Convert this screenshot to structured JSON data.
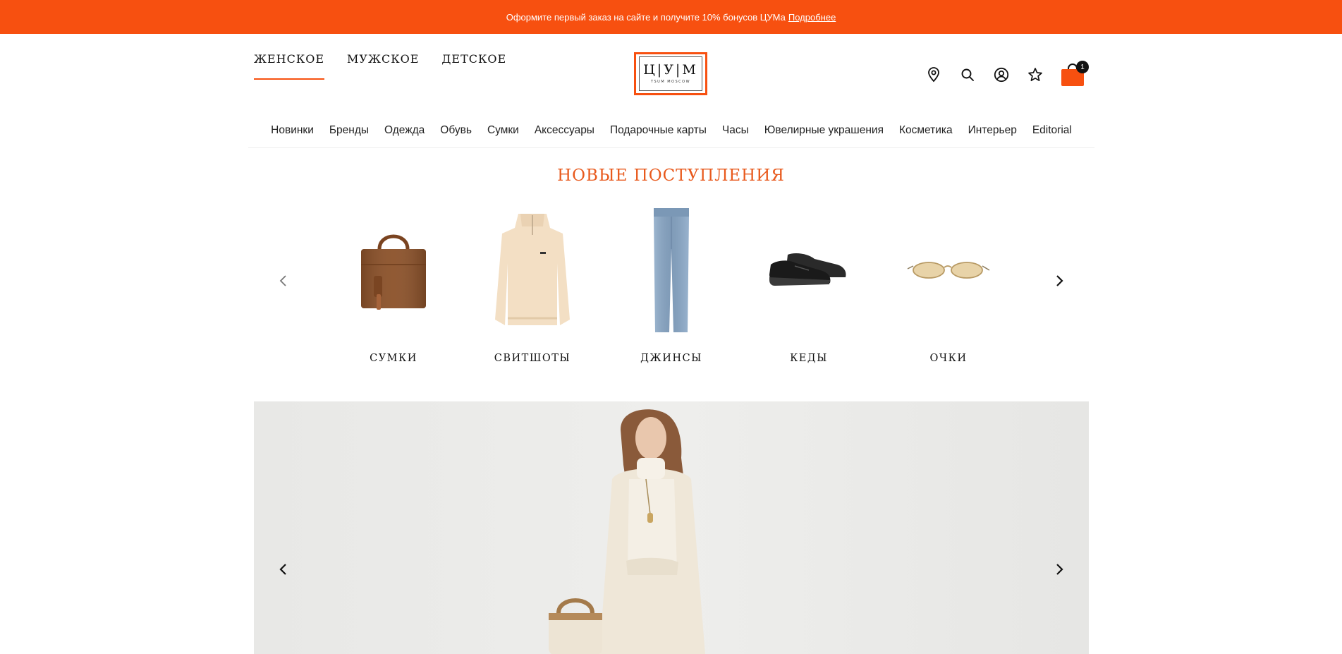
{
  "promo": {
    "text": "Оформите первый заказ на сайте и получите 10% бонусов ЦУМа",
    "link": "Подробнее"
  },
  "gender_tabs": [
    {
      "label": "ЖЕНСКОЕ",
      "active": true
    },
    {
      "label": "МУЖСКОЕ",
      "active": false
    },
    {
      "label": "ДЕТСКОЕ",
      "active": false
    }
  ],
  "logo": {
    "letters": "Ц|У|М",
    "sub": "TSUM MOSCOW"
  },
  "icons": [
    "location-icon",
    "search-icon",
    "account-icon",
    "favorites-icon",
    "cart-icon"
  ],
  "cart": {
    "count": "1"
  },
  "categories": [
    "Новинки",
    "Бренды",
    "Одежда",
    "Обувь",
    "Сумки",
    "Аксессуары",
    "Подарочные карты",
    "Часы",
    "Ювелирные украшения",
    "Косметика",
    "Интерьер",
    "Editorial"
  ],
  "new_arrivals": {
    "title": "НОВЫЕ ПОСТУПЛЕНИЯ",
    "items": [
      {
        "label": "СУМКИ",
        "icon": "bag-image"
      },
      {
        "label": "СВИТШОТЫ",
        "icon": "sweatshirt-image"
      },
      {
        "label": "ДЖИНСЫ",
        "icon": "jeans-image"
      },
      {
        "label": "КЕДЫ",
        "icon": "sneakers-image"
      },
      {
        "label": "ОЧКИ",
        "icon": "sunglasses-image"
      }
    ]
  },
  "colors": {
    "accent": "#f75010",
    "title": "#e8591c"
  }
}
